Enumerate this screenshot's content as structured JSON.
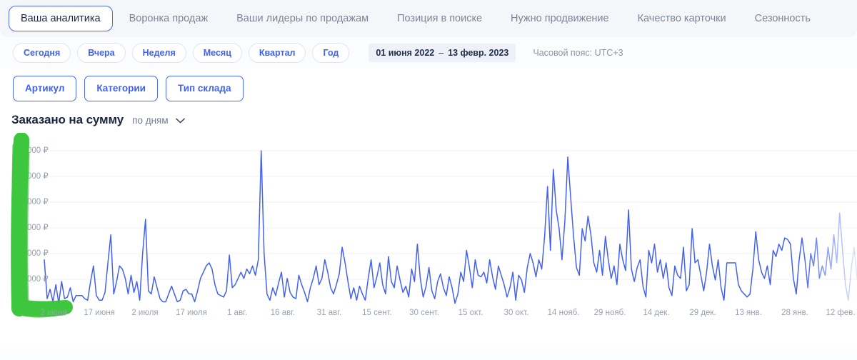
{
  "tabs": [
    {
      "label": "Ваша аналитика",
      "active": true
    },
    {
      "label": "Воронка продаж",
      "active": false
    },
    {
      "label": "Ваши лидеры по продажам",
      "active": false
    },
    {
      "label": "Позиция в поиске",
      "active": false
    },
    {
      "label": "Нужно продвижение",
      "active": false
    },
    {
      "label": "Качество карточки",
      "active": false
    },
    {
      "label": "Сезонность",
      "active": false
    }
  ],
  "period_pills": [
    {
      "label": "Сегодня"
    },
    {
      "label": "Вчера"
    },
    {
      "label": "Неделя"
    },
    {
      "label": "Месяц"
    },
    {
      "label": "Квартал"
    },
    {
      "label": "Год"
    }
  ],
  "date_range": {
    "start": "01 июня 2022",
    "separator": "–",
    "end": "13 февр. 2023"
  },
  "timezone": "Часовой пояс: UTC+3",
  "filters": [
    {
      "label": "Артикул"
    },
    {
      "label": "Категории"
    },
    {
      "label": "Тип склада"
    }
  ],
  "chart_header": {
    "title": "Заказано на сумму",
    "granularity": "по дням",
    "chevron_icon": "chevron-down-icon"
  },
  "annotation": {
    "type": "hand-drawn-marker",
    "shape": "L",
    "color": "#35c335",
    "covers": "y-axis-labels"
  },
  "colors": {
    "accent": "#3f62f4",
    "line": "#4361ee",
    "tabbar_bg": "#f4f6fa",
    "pill_border": "#dfe4f0",
    "axis_text": "#9aa2b4",
    "marker_green": "#35c335"
  },
  "chart_data": {
    "type": "line",
    "title": "Заказано на сумму",
    "xlabel": "",
    "ylabel": "₽",
    "grid": true,
    "legend": false,
    "ytick_labels": [
      "000 ₽",
      "000 ₽",
      "000 ₽",
      "000 ₽",
      "000 ₽",
      "000 ₽"
    ],
    "ytick_note": "Leading digits obscured by green hand-drawn marker annotation",
    "xtick_labels": [
      "2 июня",
      "17 июня",
      "2 июля",
      "17 июля",
      "1 авг.",
      "16 авг.",
      "31 авг.",
      "15 сент.",
      "30 сент.",
      "15 окт.",
      "30 окт.",
      "14 нояб.",
      "29 нояб.",
      "14 дек.",
      "29 дек.",
      "13 янв.",
      "28 янв.",
      "12 фев."
    ],
    "series": [
      {
        "name": "Заказано на сумму",
        "color": "#4361ee",
        "values": [
          30,
          5,
          11,
          3,
          14,
          2,
          16,
          5,
          6,
          12,
          3,
          7,
          7,
          7,
          5,
          4,
          16,
          26,
          7,
          4,
          4,
          9,
          28,
          46,
          8,
          16,
          26,
          24,
          18,
          8,
          20,
          9,
          16,
          4,
          34,
          56,
          10,
          8,
          19,
          12,
          5,
          3,
          3,
          8,
          13,
          8,
          3,
          4,
          10,
          11,
          8,
          8,
          3,
          10,
          18,
          22,
          26,
          28,
          24,
          14,
          8,
          7,
          6,
          10,
          33,
          12,
          14,
          18,
          22,
          18,
          24,
          21,
          26,
          20,
          30,
          100,
          34,
          8,
          4,
          12,
          7,
          15,
          22,
          6,
          18,
          9,
          6,
          5,
          20,
          14,
          9,
          3,
          12,
          18,
          26,
          14,
          18,
          30,
          22,
          12,
          8,
          14,
          21,
          38,
          28,
          16,
          5,
          12,
          4,
          13,
          8,
          4,
          18,
          30,
          12,
          19,
          28,
          14,
          8,
          32,
          16,
          12,
          26,
          17,
          9,
          13,
          6,
          24,
          16,
          40,
          18,
          6,
          13,
          25,
          10,
          5,
          16,
          21,
          12,
          7,
          19,
          12,
          2,
          8,
          22,
          16,
          36,
          25,
          12,
          30,
          20,
          19,
          22,
          15,
          30,
          19,
          11,
          26,
          20,
          14,
          6,
          12,
          22,
          4,
          20,
          17,
          9,
          25,
          34,
          28,
          19,
          30,
          24,
          45,
          77,
          36,
          88,
          62,
          50,
          30,
          55,
          96,
          70,
          45,
          25,
          20,
          50,
          42,
          58,
          46,
          28,
          22,
          36,
          20,
          45,
          30,
          18,
          26,
          14,
          40,
          30,
          23,
          62,
          24,
          16,
          25,
          30,
          13,
          6,
          36,
          28,
          40,
          22,
          30,
          18,
          28,
          12,
          7,
          26,
          20,
          18,
          38,
          10,
          14,
          50,
          28,
          30,
          20,
          10,
          22,
          40,
          26,
          17,
          30,
          12,
          4,
          28,
          28,
          28,
          28,
          14,
          10,
          8,
          6,
          8,
          24,
          48,
          30,
          22,
          18,
          26,
          14,
          36,
          32,
          40,
          36,
          44,
          43,
          40,
          18,
          8,
          30,
          44,
          30,
          12,
          34,
          26,
          44,
          18,
          26,
          20,
          38,
          24,
          46,
          28,
          60,
          36,
          14,
          4,
          24,
          38,
          18
        ]
      }
    ]
  }
}
